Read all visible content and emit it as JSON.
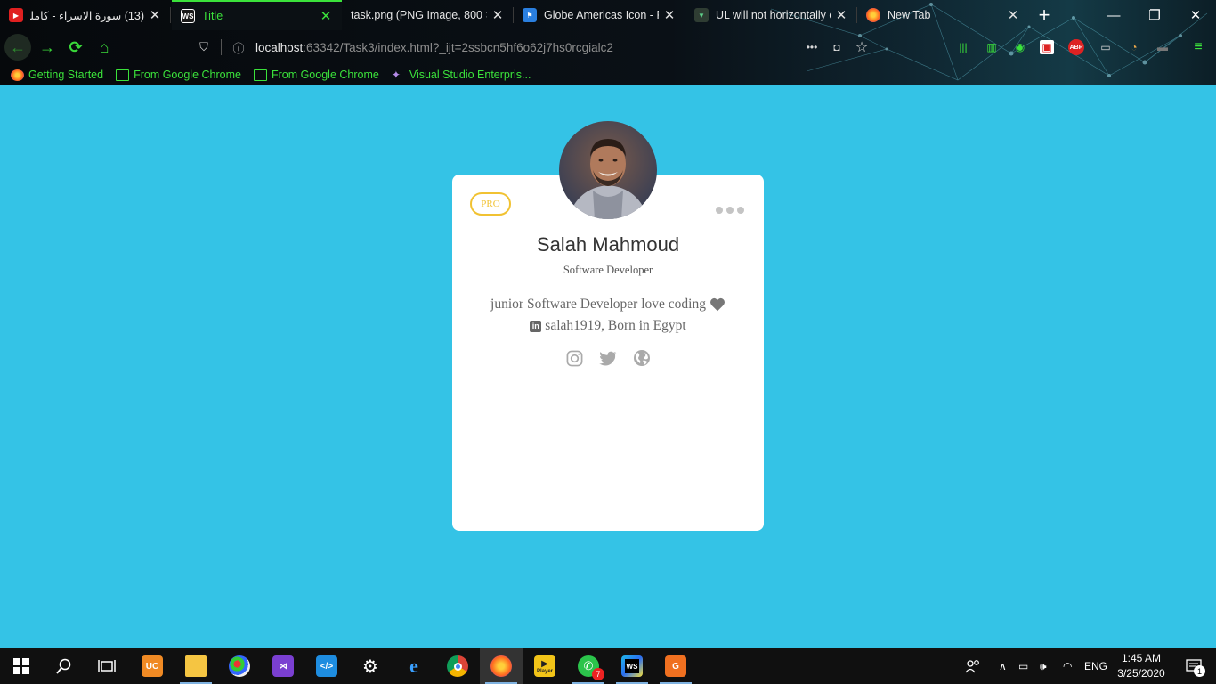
{
  "browser": {
    "tabs": [
      {
        "title": "(13) سورة الاسراء - كامله |",
        "icon": "youtube-icon",
        "active": false
      },
      {
        "title": "Title",
        "icon": "webstorm-icon",
        "active": true
      },
      {
        "title": "task.png (PNG Image, 800 × 6",
        "icon": "none",
        "active": false
      },
      {
        "title": "Globe Americas Icon - Re",
        "icon": "flag-icon",
        "active": false
      },
      {
        "title": "UL will not horizontally c",
        "icon": "vue-icon",
        "active": false
      },
      {
        "title": "New Tab",
        "icon": "firefox-icon",
        "active": false
      }
    ],
    "new_tab_label": "+",
    "window_controls": {
      "minimize": "—",
      "restore": "❐",
      "close": "✕"
    },
    "url": {
      "host": "localhost",
      "rest": ":63342/Task3/index.html?_ijt=2ssbcn5hf6o62j7hs0rcgialc2"
    },
    "bookmarks": [
      {
        "label": "Getting Started",
        "icon": "firefox-icon"
      },
      {
        "label": "From Google Chrome",
        "icon": "folder-icon"
      },
      {
        "label": "From Google Chrome",
        "icon": "folder-icon"
      },
      {
        "label": "Visual Studio Enterpris...",
        "icon": "visual-studio-icon"
      }
    ],
    "toolbar_labels": {
      "abp": "ABP"
    },
    "accent_color": "#3be23b"
  },
  "profile": {
    "badge": "PRO",
    "name": "Salah Mahmoud",
    "role": "Software Developer",
    "bio_line1": "junior Software Developer love coding",
    "bio_line2": "salah1919, Born in Egypt",
    "socials": [
      "instagram-icon",
      "twitter-icon",
      "globe-icon"
    ],
    "background_color": "#34c3e6",
    "badge_color": "#f1c232"
  },
  "taskbar": {
    "apps": [
      "start-icon",
      "search-icon",
      "task-view-icon",
      "uc-browser-icon",
      "file-explorer-icon",
      "paint-icon",
      "visual-studio-icon",
      "vscode-icon",
      "settings-icon",
      "internet-explorer-icon",
      "chrome-icon",
      "firefox-icon",
      "player-icon",
      "whatsapp-icon",
      "webstorm-icon",
      "pdf-icon"
    ],
    "whatsapp_badge": "7",
    "player_label": "Player",
    "language": "ENG",
    "time": "1:45 AM",
    "date": "3/25/2020",
    "notification_count": "1"
  }
}
